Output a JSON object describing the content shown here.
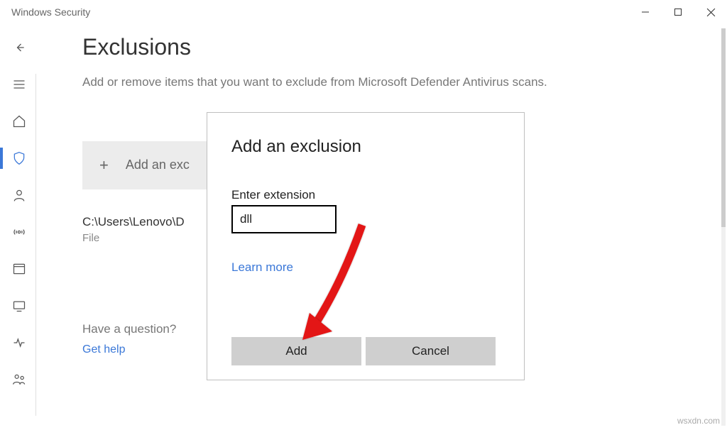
{
  "window": {
    "title": "Windows Security"
  },
  "page": {
    "title": "Exclusions",
    "description": "Add or remove items that you want to exclude from Microsoft Defender Antivirus scans.",
    "add_button_label": "Add an exc",
    "exclusion": {
      "path": "C:\\Users\\Lenovo\\D",
      "type": "File"
    },
    "question_label": "Have a question?",
    "get_help": "Get help"
  },
  "dialog": {
    "title": "Add an exclusion",
    "field_label": "Enter extension",
    "field_value": "dll",
    "learn_more": "Learn more",
    "add": "Add",
    "cancel": "Cancel"
  },
  "watermark": "wsxdn.com"
}
